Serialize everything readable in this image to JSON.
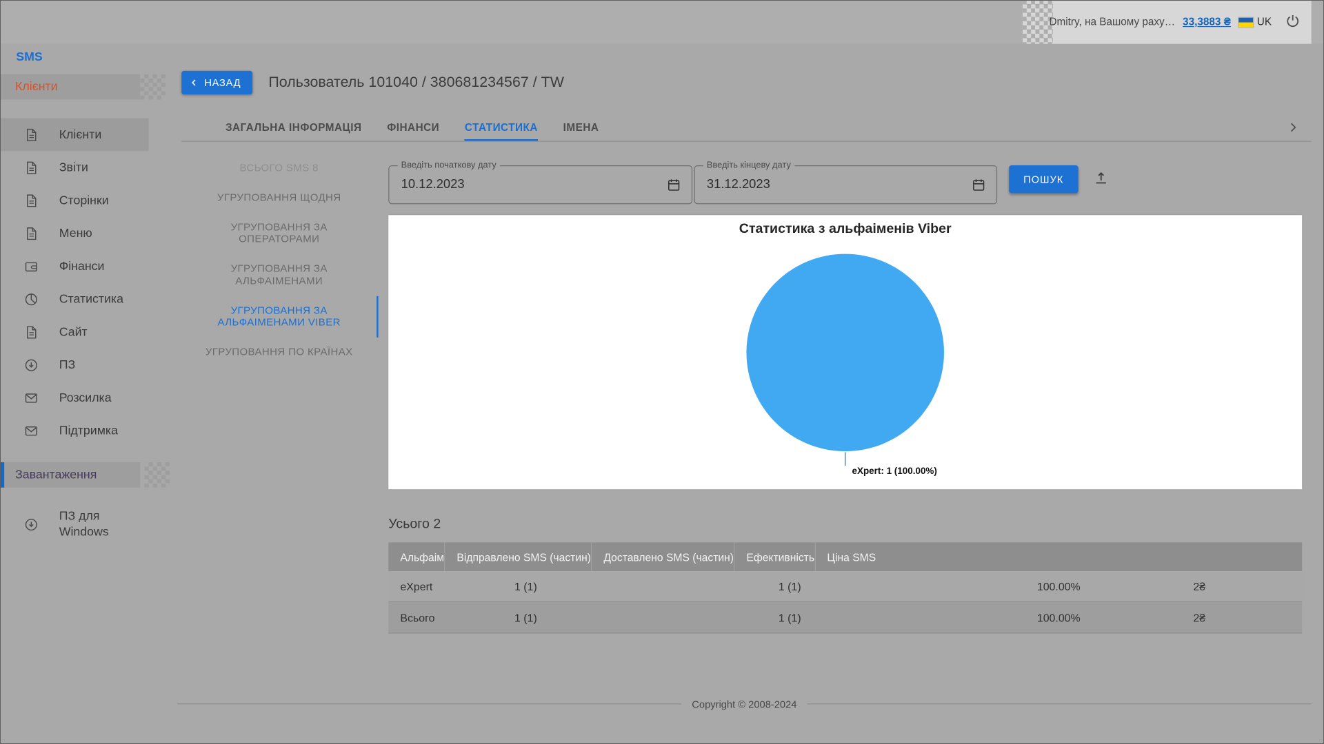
{
  "topbar": {
    "user_text": "Dmitry, на Вашому раху…",
    "balance": "33,3883 ₴",
    "language": "UK"
  },
  "sidebar": {
    "section": "SMS",
    "group_clients": "Клієнти",
    "items": [
      {
        "label": "Клієнти",
        "icon": "document-icon",
        "active": true
      },
      {
        "label": "Звіти",
        "icon": "document-icon"
      },
      {
        "label": "Сторінки",
        "icon": "document-icon"
      },
      {
        "label": "Меню",
        "icon": "document-icon"
      },
      {
        "label": "Фінанси",
        "icon": "wallet-icon"
      },
      {
        "label": "Статистика",
        "icon": "pie-chart-icon"
      },
      {
        "label": "Сайт",
        "icon": "document-icon"
      },
      {
        "label": "ПЗ",
        "icon": "download-icon"
      },
      {
        "label": "Розсилка",
        "icon": "envelope-icon"
      },
      {
        "label": "Підтримка",
        "icon": "envelope-icon"
      }
    ],
    "group_downloads": "Завантаження",
    "windows_item": {
      "label": "ПЗ для Windows",
      "icon": "download-icon"
    }
  },
  "header": {
    "back_label": "НАЗАД",
    "title": "Пользователь 101040 / 380681234567 / TW"
  },
  "tabs": [
    {
      "label": "ЗАГАЛЬНА ІНФОРМАЦІЯ"
    },
    {
      "label": "ФІНАНСИ"
    },
    {
      "label": "СТАТИСТИКА",
      "active": true
    },
    {
      "label": "ІМЕНА"
    }
  ],
  "subnav": [
    {
      "label": "ВСЬОГО SMS 8",
      "disabled": true
    },
    {
      "label": "УГРУПОВАННЯ ЩОДНЯ"
    },
    {
      "label": "УГРУПОВАННЯ ЗА ОПЕРАТОРАМИ"
    },
    {
      "label": "УГРУПОВАННЯ ЗА АЛЬФАІМЕНАМИ"
    },
    {
      "label": "УГРУПОВАННЯ ЗА АЛЬФАІМЕНАМИ VIBER",
      "active": true
    },
    {
      "label": "УГРУПОВАННЯ ПО КРАЇНАХ"
    }
  ],
  "filters": {
    "start_label": "Введіть початкову дату",
    "start_value": "10.12.2023",
    "end_label": "Введіть кінцеву дату",
    "end_value": "31.12.2023",
    "search_label": "ПОШУК"
  },
  "chart_data": {
    "type": "pie",
    "title": "Статистика з альфаіменів Viber",
    "series": [
      {
        "label": "eXpert",
        "value": 1,
        "percent": 100.0
      }
    ],
    "callout": "eXpert: 1 (100.00%)",
    "color": "#41a9f2",
    "legend_position": "none"
  },
  "summary": {
    "total_label": "Усього 2"
  },
  "table": {
    "headers": [
      "Альфаім",
      "Відправлено SMS (частин)",
      "Доставлено SMS (частин)",
      "Ефективність",
      "Ціна SMS"
    ],
    "rows": [
      [
        "eXpert",
        "1 (1)",
        "1 (1)",
        "100.00%",
        "2₴"
      ],
      [
        "Всього",
        "1 (1)",
        "1 (1)",
        "100.00%",
        "2₴"
      ]
    ]
  },
  "footer": {
    "copyright": "Copyright © 2008-2024"
  }
}
